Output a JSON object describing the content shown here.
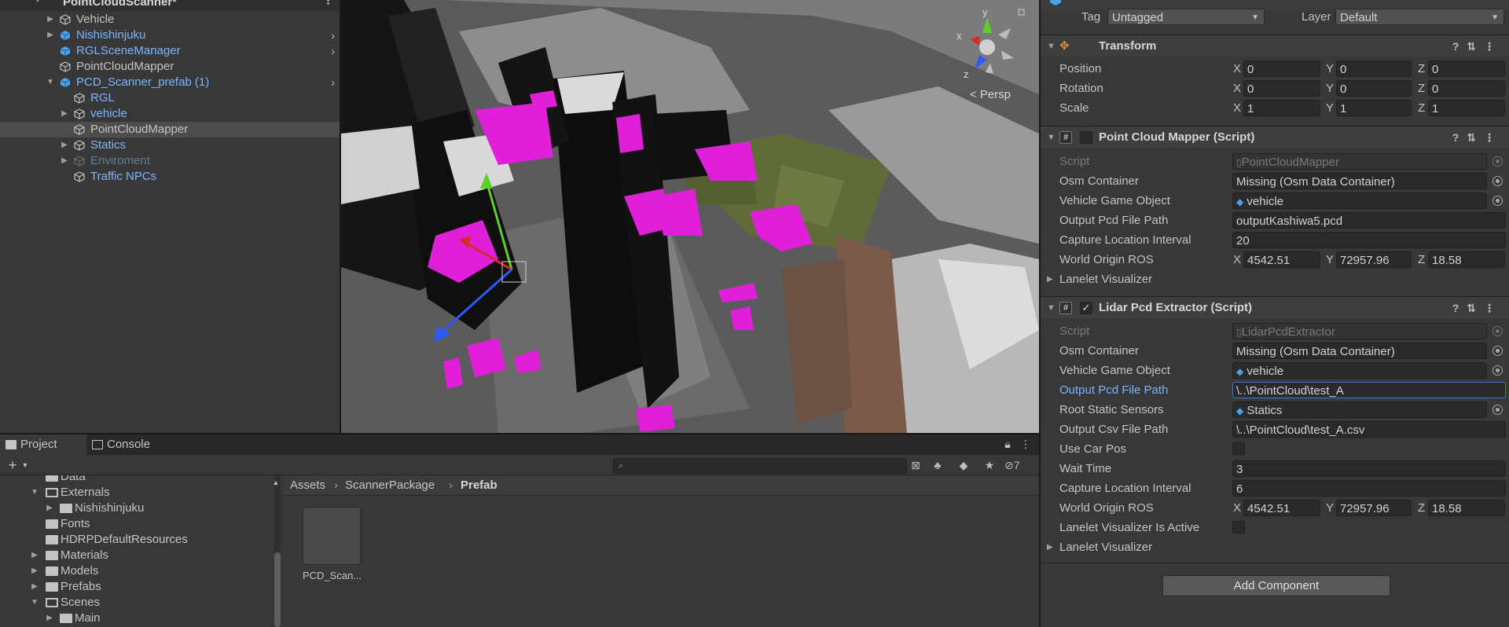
{
  "hierarchy": {
    "scene_name": "PointCloudScanner*",
    "items": [
      {
        "label": "Vehicle"
      },
      {
        "label": "Nishishinjuku"
      },
      {
        "label": "RGLSceneManager"
      },
      {
        "label": "PointCloudMapper"
      },
      {
        "label": "PCD_Scanner_prefab (1)"
      },
      {
        "label": "RGL"
      },
      {
        "label": "vehicle"
      },
      {
        "label": "PointCloudMapper"
      },
      {
        "label": "Statics"
      },
      {
        "label": "Enviroment"
      },
      {
        "label": "Traffic NPCs"
      }
    ]
  },
  "scene_view": {
    "projection_label": "Persp",
    "gizmo": {
      "x": "x",
      "y": "y",
      "z": "z"
    }
  },
  "bottom_panel": {
    "tabs": [
      "Project",
      "Console"
    ],
    "hidden_count": "7",
    "breadcrumb": [
      "Assets",
      "ScannerPackage",
      "Prefab"
    ],
    "folders": [
      "Data",
      "Externals",
      "Nishishinjuku",
      "Fonts",
      "HDRPDefaultResources",
      "Materials",
      "Models",
      "Prefabs",
      "Scenes",
      "Main"
    ],
    "asset_label": "PCD_Scan..."
  },
  "inspector": {
    "tag_label": "Tag",
    "tag_value": "Untagged",
    "layer_label": "Layer",
    "layer_value": "Default",
    "transform": {
      "title": "Transform",
      "position_label": "Position",
      "rotation_label": "Rotation",
      "scale_label": "Scale",
      "position": [
        "0",
        "0",
        "0"
      ],
      "rotation": [
        "0",
        "0",
        "0"
      ],
      "scale": [
        "1",
        "1",
        "1"
      ]
    },
    "axis_x": "X",
    "axis_y": "Y",
    "axis_z": "Z",
    "mapper": {
      "title": "Point Cloud Mapper (Script)",
      "enabled": false,
      "script_label": "Script",
      "script_value": "PointCloudMapper",
      "osm_label": "Osm Container",
      "osm_value": "Missing (Osm Data Container)",
      "vehicle_label": "Vehicle Game Object",
      "vehicle_value": "vehicle",
      "pcd_label": "Output Pcd File Path",
      "pcd_value": "outputKashiwa5.pcd",
      "interval_label": "Capture Location Interval",
      "interval_value": "20",
      "origin_label": "World Origin ROS",
      "origin": [
        "4542.51",
        "72957.96",
        "18.58"
      ],
      "lanelet_label": "Lanelet Visualizer"
    },
    "lidar": {
      "title": "Lidar Pcd Extractor (Script)",
      "enabled": true,
      "script_label": "Script",
      "script_value": "LidarPcdExtractor",
      "osm_label": "Osm Container",
      "osm_value": "Missing (Osm Data Container)",
      "vehicle_label": "Vehicle Game Object",
      "vehicle_value": "vehicle",
      "pcd_label": "Output Pcd File Path",
      "pcd_value": "\\..\\PointCloud\\test_A",
      "root_label": "Root Static Sensors",
      "root_value": "Statics",
      "csv_label": "Output Csv File Path",
      "csv_value": "\\..\\PointCloud\\test_A.csv",
      "carpos_label": "Use Car Pos",
      "wait_label": "Wait Time",
      "wait_value": "3",
      "interval_label": "Capture Location Interval",
      "interval_value": "6",
      "origin_label": "World Origin ROS",
      "origin": [
        "4542.51",
        "72957.96",
        "18.58"
      ],
      "lanelet_active_label": "Lanelet Visualizer Is Active",
      "lanelet_label": "Lanelet Visualizer"
    },
    "add_component": "Add Component"
  },
  "colors": {
    "panel": "#383838",
    "selection": "#4d4d4d",
    "prefab_blue": "#7ab6ff",
    "point_cloud_magenta": "#e020d8",
    "focus_border": "#3a79bb"
  }
}
